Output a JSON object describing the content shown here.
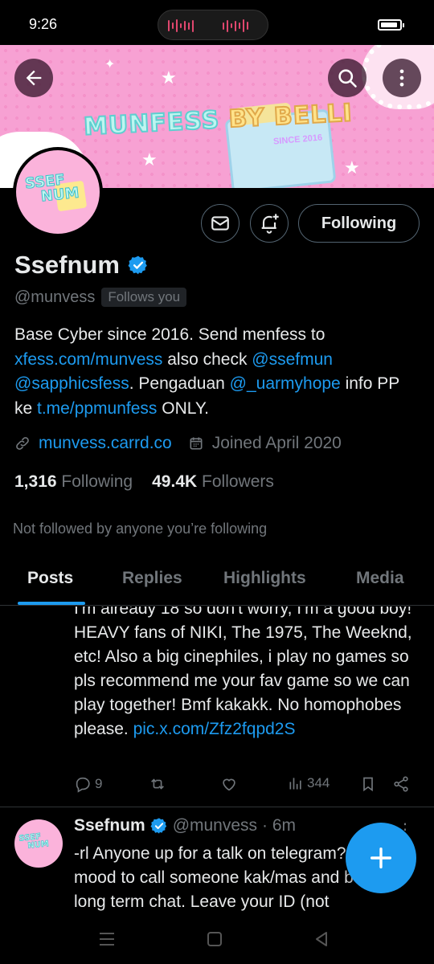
{
  "status_bar": {
    "time": "9:26"
  },
  "banner": {
    "title_main": "MUNFESS",
    "title_by": "BY BELLI",
    "subtitle": "SINCE 2016"
  },
  "avatar": {
    "text_line1": "SSEF",
    "text_line2": "NUM"
  },
  "profile": {
    "display_name": "Ssefnum",
    "handle": "@munvess",
    "follows_you": "Follows you",
    "following_button": "Following",
    "bio": {
      "t1": "Base Cyber since 2016. Send menfess to ",
      "l1": "xfess.com/munvess",
      "t2": " also check ",
      "l2": "@ssefmun",
      "t3": " ",
      "l3": "@sapphicsfess",
      "t4": ". Pengaduan ",
      "l4": "@_uarmyhope",
      "t5": " info PP ke ",
      "l5": "t.me/ppmunfess",
      "t6": " ONLY."
    },
    "website": "munvess.carrd.co",
    "joined": "Joined April 2020",
    "following_count": "1,316",
    "following_label": "Following",
    "followers_count": "49.4K",
    "followers_label": "Followers",
    "not_followed": "Not followed by anyone you’re following"
  },
  "tabs": [
    "Posts",
    "Replies",
    "Highlights",
    "Media"
  ],
  "tweet1": {
    "text": "I'm already 18 so don't worry, I'm a good boy! HEAVY fans of NIKI, The 1975, The Weeknd, etc! Also a big cinephiles, i play no games so pls recommend me your fav game so we can play together! Bmf kakakk. No homophobes please.",
    "link": "pic.x.com/Zfz2fqpd2S",
    "replies": "9",
    "views": "344"
  },
  "tweet2": {
    "name": "Ssefnum",
    "handle": "@munvess",
    "time": "· 6m",
    "text": "-rl Anyone up for a talk on telegram? i'm in a mood to call someone kak/mas and built a long term chat. Leave your ID (not"
  },
  "colors": {
    "accent": "#1d9bf0",
    "background": "#000000",
    "muted": "#71767b",
    "banner_pink": "#f7a1d3"
  }
}
